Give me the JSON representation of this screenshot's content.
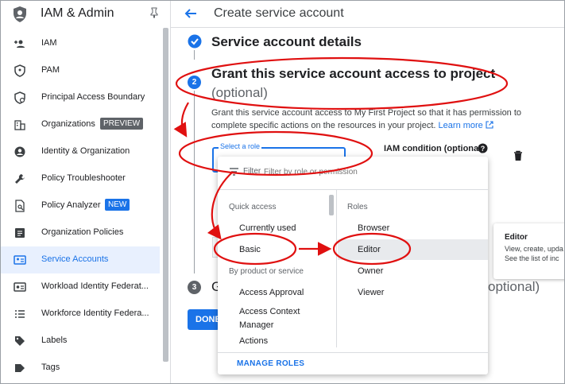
{
  "app": {
    "title": "IAM & Admin"
  },
  "sidebar": {
    "items": [
      {
        "label": "IAM",
        "icon": "person-add-icon"
      },
      {
        "label": "PAM",
        "icon": "shield-key-icon"
      },
      {
        "label": "Principal Access Boundary",
        "icon": "boundary-icon"
      },
      {
        "label": "Organizations",
        "icon": "organization-icon",
        "badge": "PREVIEW"
      },
      {
        "label": "Identity & Organization",
        "icon": "account-circle-icon"
      },
      {
        "label": "Policy Troubleshooter",
        "icon": "wrench-icon"
      },
      {
        "label": "Policy Analyzer",
        "icon": "policy-analyzer-icon",
        "badge": "NEW"
      },
      {
        "label": "Organization Policies",
        "icon": "document-icon"
      },
      {
        "label": "Service Accounts",
        "icon": "service-account-icon",
        "active": true
      },
      {
        "label": "Workload Identity Federat...",
        "icon": "workload-icon"
      },
      {
        "label": "Workforce Identity Federa...",
        "icon": "list-icon"
      },
      {
        "label": "Labels",
        "icon": "label-icon"
      },
      {
        "label": "Tags",
        "icon": "tag-icon"
      }
    ]
  },
  "header": {
    "title": "Create service account"
  },
  "steps": {
    "step1": {
      "title": "Service account details"
    },
    "step2": {
      "number": "2",
      "title": "Grant this service account access to project",
      "optional": "(optional)",
      "description": "Grant this service account access to My First Project so that it has permission to complete specific actions on the resources in your project.",
      "learn_more": "Learn more"
    },
    "step3": {
      "number": "3",
      "title": "G",
      "optional": "optional)"
    }
  },
  "role_field": {
    "label": "Select a role"
  },
  "iam_condition": {
    "label": "IAM condition (optional)"
  },
  "done_button": {
    "label": "DONE"
  },
  "dropdown": {
    "filter_label": "Filter",
    "filter_placeholder": "Filter by role or permission",
    "left": {
      "quick_access": "Quick access",
      "currently_used": "Currently used",
      "basic": "Basic",
      "by_product": "By product or service",
      "access_approval": "Access Approval",
      "access_context_manager": "Access Context Manager",
      "actions": "Actions"
    },
    "right": {
      "header": "Roles",
      "browser": "Browser",
      "editor": "Editor",
      "owner": "Owner",
      "viewer": "Viewer"
    },
    "manage_roles": "MANAGE ROLES"
  },
  "tooltip": {
    "title": "Editor",
    "line1": "View, create, upda",
    "line2": "See the list of inc"
  },
  "colors": {
    "accent": "#1a73e8",
    "annotation": "#e01010"
  }
}
